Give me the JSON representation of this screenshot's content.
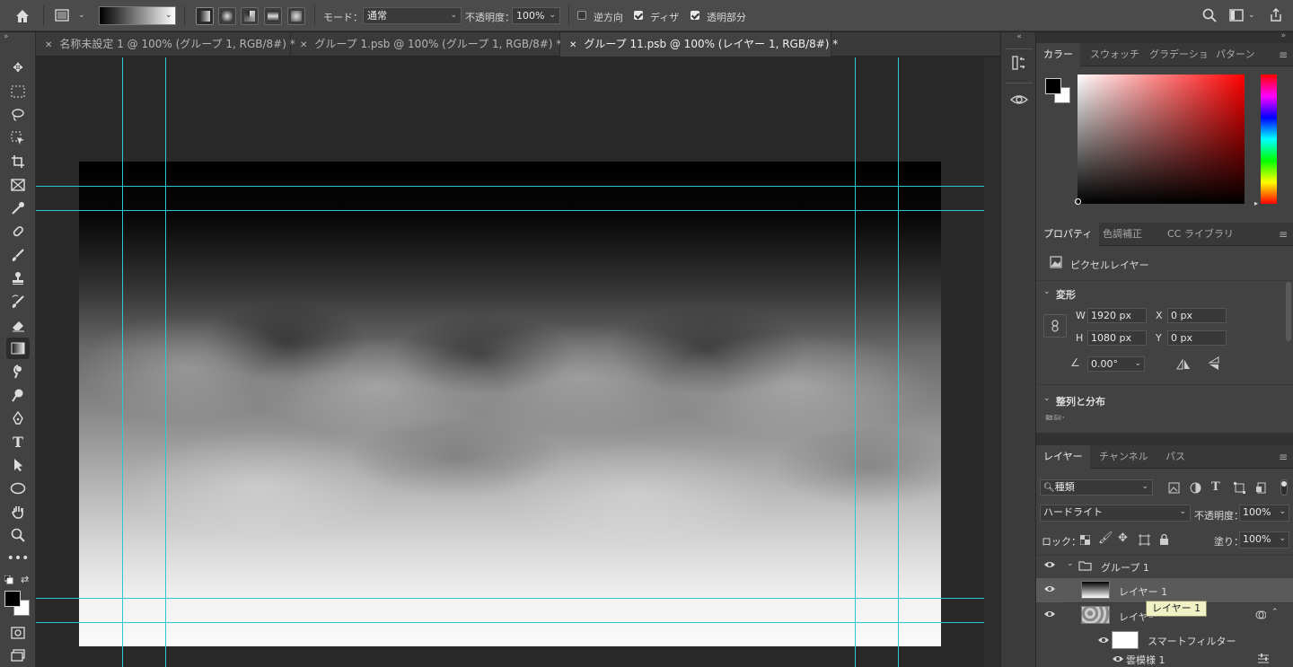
{
  "options_bar": {
    "mode_label": "モード：",
    "mode_value": "通常",
    "opacity_label": "不透明度：",
    "opacity_value": "100%",
    "reverse_label": "逆方向",
    "dither_label": "ディザ",
    "transparency_label": "透明部分"
  },
  "tabs": [
    {
      "label": "名称未設定 1 @ 100% (グループ 1, RGB/8#) *",
      "active": false
    },
    {
      "label": "グループ 1.psb @ 100% (グループ 1, RGB/8#) *",
      "active": false
    },
    {
      "label": "グループ 11.psb @ 100% (レイヤー 1, RGB/8#) *",
      "active": true
    }
  ],
  "color_panel": {
    "tabs": [
      "カラー",
      "スウォッチ",
      "グラデーショ",
      "パターン"
    ],
    "accent": "#ff0000"
  },
  "properties_panel": {
    "tabs": [
      "プロパティ",
      "色調補正",
      "CC ライブラリ"
    ],
    "layer_type": "ピクセルレイヤー",
    "transform_title": "変形",
    "w_label": "W",
    "w_value": "1920 px",
    "h_label": "H",
    "h_value": "1080 px",
    "x_label": "X",
    "x_value": "0 px",
    "y_label": "Y",
    "y_value": "0 px",
    "angle_value": "0.00°",
    "align_title": "整列と分布",
    "align_sub": "整列："
  },
  "layers_panel": {
    "tabs": [
      "レイヤー",
      "チャンネル",
      "パス"
    ],
    "filter_value": "種類",
    "blend_mode": "ハードライト",
    "opacity_label": "不透明度：",
    "opacity_value": "100%",
    "lock_label": "ロック：",
    "fill_label": "塗り：",
    "fill_value": "100%",
    "group_name": "グループ 1",
    "layer1_name": "レイヤー 1",
    "layer2_name": "レイヤー 2",
    "smart_filter_label": "スマートフィルター",
    "filter_item": "雲模様 1",
    "tooltip": "レイヤー 1"
  }
}
